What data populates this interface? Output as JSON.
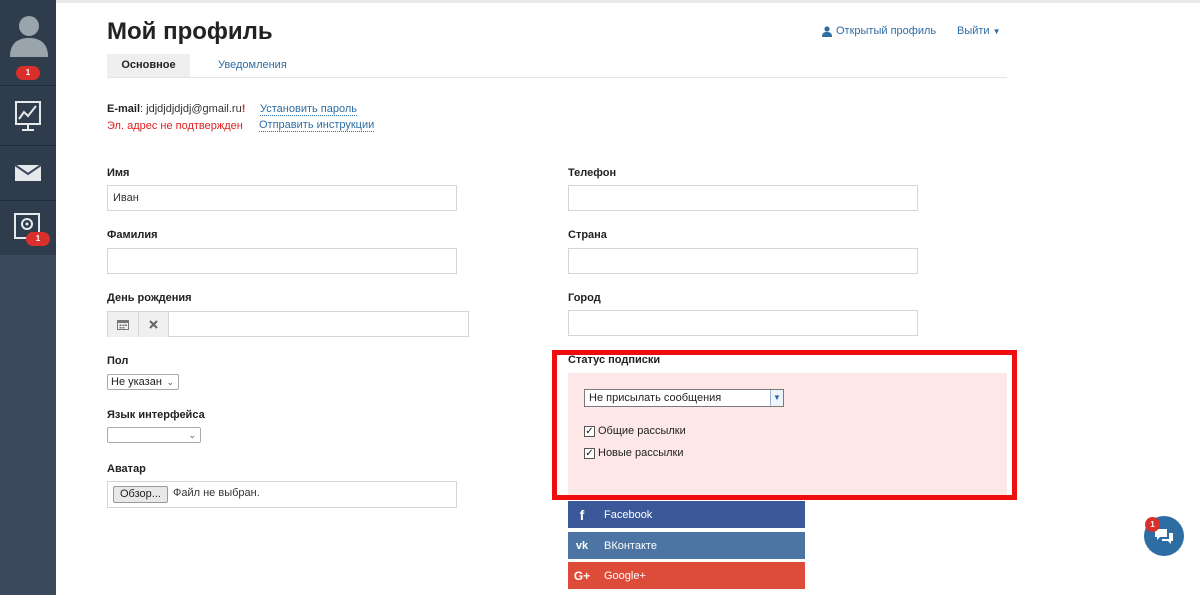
{
  "page": {
    "title": "Мой профиль"
  },
  "header": {
    "profile_link": "Открытый профиль",
    "logout": "Выйти"
  },
  "tabs": [
    {
      "label": "Основное",
      "active": true
    },
    {
      "label": "Уведомления",
      "active": false
    }
  ],
  "sidebar": {
    "badges": {
      "avatar": "1",
      "settings": "1"
    },
    "items": [
      {
        "icon": "avatar-icon"
      },
      {
        "icon": "chart-icon"
      },
      {
        "icon": "mail-icon"
      },
      {
        "icon": "settings-icon"
      }
    ]
  },
  "email": {
    "label": "E-mail",
    "value": "jdjdjdjdjdj@gmail.ru",
    "warning_mark": "!",
    "warning": "Эл. адрес не подтвержден",
    "set_password": "Установить пароль",
    "send_instructions": "Отправить инструкции"
  },
  "form": {
    "first_name": {
      "label": "Имя",
      "value": "Иван"
    },
    "last_name": {
      "label": "Фамилия",
      "value": ""
    },
    "birthday": {
      "label": "День рождения",
      "value": ""
    },
    "gender": {
      "label": "Пол",
      "value": "Не указан"
    },
    "language": {
      "label": "Язык интерфейса",
      "value": ""
    },
    "avatar": {
      "label": "Аватар",
      "button": "Обзор...",
      "status": "Файл не выбран."
    },
    "phone": {
      "label": "Телефон",
      "value": ""
    },
    "country": {
      "label": "Страна",
      "value": ""
    },
    "city": {
      "label": "Город",
      "value": ""
    }
  },
  "subscription": {
    "label": "Статус подписки",
    "value": "Не присылать сообщения",
    "options": [
      {
        "label": "Общие рассылки",
        "checked": true
      },
      {
        "label": "Новые рассылки",
        "checked": true
      }
    ]
  },
  "social": [
    {
      "name": "Facebook",
      "glyph": "f",
      "color": "#3b5998"
    },
    {
      "name": "ВКонтакте",
      "glyph": "vk",
      "color": "#4c75a3"
    },
    {
      "name": "Google+",
      "glyph": "G+",
      "color": "#dd4b39"
    }
  ],
  "chat": {
    "badge": "1"
  },
  "colors": {
    "highlight_frame": "#f00d0d",
    "panel": "#fde8e7",
    "link": "#2e6da4",
    "sidebar": "#3a4a5c"
  }
}
